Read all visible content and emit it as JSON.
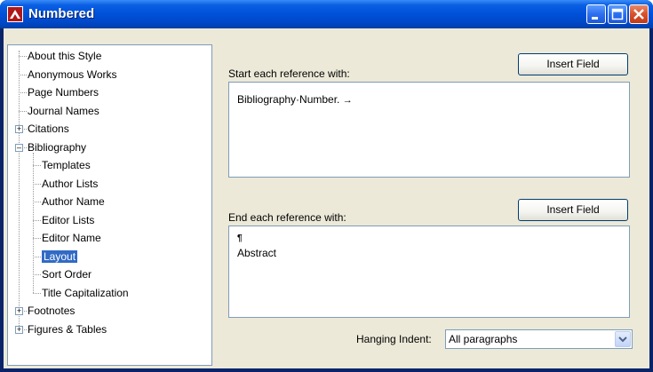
{
  "window": {
    "title": "Numbered"
  },
  "tree": {
    "items": [
      {
        "label": "About this Style",
        "level": 0,
        "expander": ""
      },
      {
        "label": "Anonymous Works",
        "level": 0,
        "expander": ""
      },
      {
        "label": "Page Numbers",
        "level": 0,
        "expander": ""
      },
      {
        "label": "Journal Names",
        "level": 0,
        "expander": ""
      },
      {
        "label": "Citations",
        "level": 0,
        "expander": "+"
      },
      {
        "label": "Bibliography",
        "level": 0,
        "expander": "−"
      },
      {
        "label": "Templates",
        "level": 1,
        "expander": ""
      },
      {
        "label": "Author Lists",
        "level": 1,
        "expander": ""
      },
      {
        "label": "Author Name",
        "level": 1,
        "expander": ""
      },
      {
        "label": "Editor Lists",
        "level": 1,
        "expander": ""
      },
      {
        "label": "Editor Name",
        "level": 1,
        "expander": ""
      },
      {
        "label": "Layout",
        "level": 1,
        "expander": "",
        "selected": true
      },
      {
        "label": "Sort Order",
        "level": 1,
        "expander": ""
      },
      {
        "label": "Title Capitalization",
        "level": 1,
        "expander": ""
      },
      {
        "label": "Footnotes",
        "level": 0,
        "expander": "+"
      },
      {
        "label": "Figures & Tables",
        "level": 0,
        "expander": "+"
      }
    ]
  },
  "start": {
    "label": "Start each reference with:",
    "button": "Insert Field",
    "content": "Bibliography·Number.",
    "tab_mark": "→"
  },
  "end": {
    "label": "End each reference with:",
    "button": "Insert Field",
    "pilcrow": "¶",
    "content": "Abstract"
  },
  "hanging": {
    "label": "Hanging Indent:",
    "value": "All paragraphs"
  },
  "colors": {
    "titlebar": "#0050d8",
    "selection": "#316ac5",
    "close": "#c23a18"
  }
}
